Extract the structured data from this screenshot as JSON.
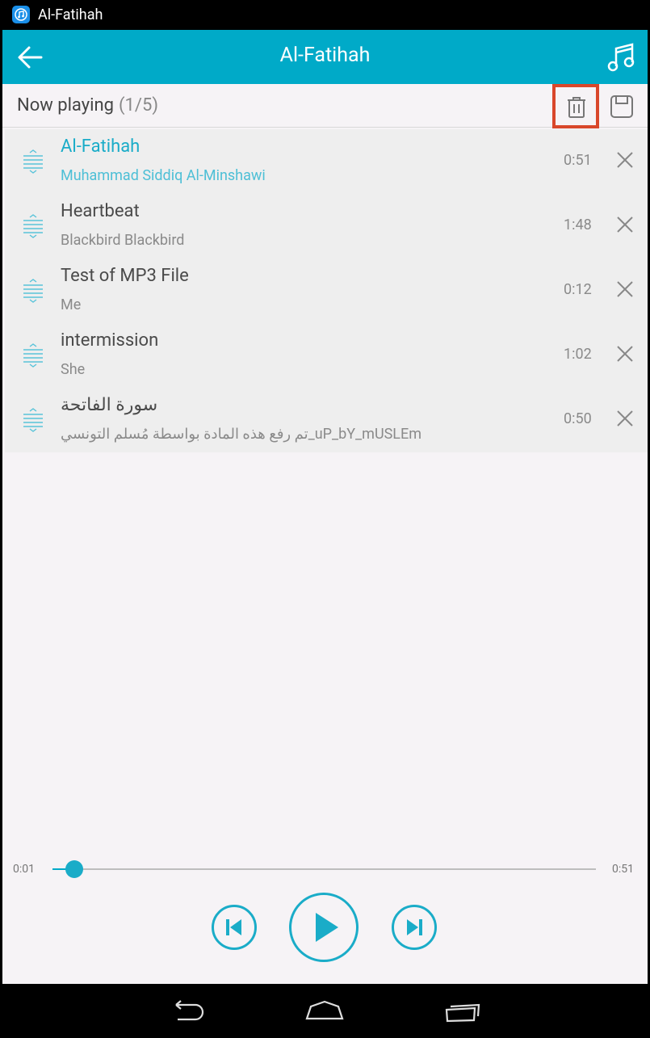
{
  "status_bar": {
    "app_title": "Al-Fatihah"
  },
  "action_bar": {
    "title": "Al-Fatihah",
    "back_icon": "arrow-left-icon",
    "music_icon": "music-note-icon"
  },
  "now_playing": {
    "label": "Now playing",
    "count": "(1/5)"
  },
  "colors": {
    "accent": "#00aac8",
    "highlight_border": "#d9472b",
    "background": "#f6f3f6"
  },
  "playlist": [
    {
      "title": "Al-Fatihah",
      "artist": "Muhammad Siddiq Al-Minshawi",
      "duration": "0:51",
      "active": true
    },
    {
      "title": "Heartbeat",
      "artist": "Blackbird Blackbird",
      "duration": "1:48",
      "active": false
    },
    {
      "title": "Test of MP3 File",
      "artist": "Me",
      "duration": "0:12",
      "active": false
    },
    {
      "title": "intermission",
      "artist": "She",
      "duration": "1:02",
      "active": false
    },
    {
      "title": "سورة الفاتحة",
      "artist": "تم رفع هذه المادة بواسطة مُسلم التونسي_uP_bY_mUSLEm",
      "duration": "0:50",
      "active": false
    }
  ],
  "player": {
    "current_time": "0:01",
    "total_time": "0:51",
    "progress": 0.04
  }
}
